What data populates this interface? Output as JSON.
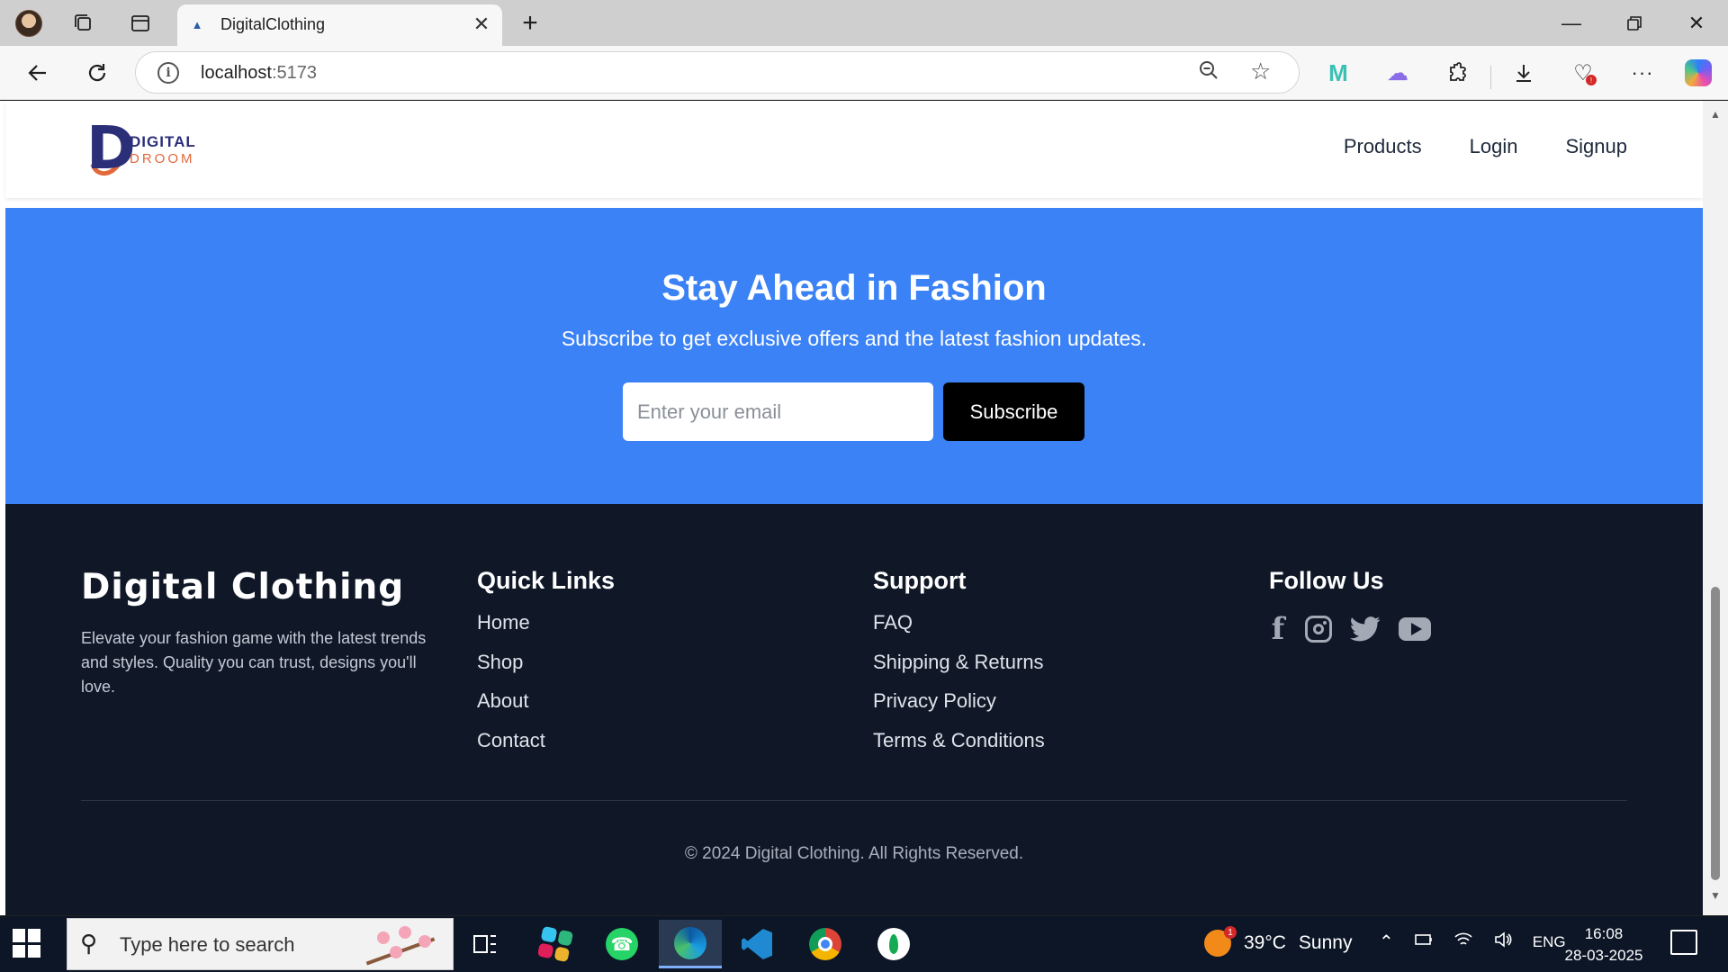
{
  "browser": {
    "tab_title": "DigitalClothing",
    "url_host": "localhost",
    "url_port": ":5173"
  },
  "site": {
    "logo_top": "DIGITAL",
    "logo_bottom": "DROOM",
    "nav": [
      "Products",
      "Login",
      "Signup"
    ]
  },
  "subscribe": {
    "title": "Stay Ahead in Fashion",
    "subtitle": "Subscribe to get exclusive offers and the latest fashion updates.",
    "email_placeholder": "Enter your email",
    "button": "Subscribe"
  },
  "footer": {
    "brand": "Digital Clothing",
    "description": "Elevate your fashion game with the latest trends and styles. Quality you can trust, designs you'll love.",
    "quick_links": {
      "title": "Quick Links",
      "items": [
        "Home",
        "Shop",
        "About",
        "Contact"
      ]
    },
    "support": {
      "title": "Support",
      "items": [
        "FAQ",
        "Shipping & Returns",
        "Privacy Policy",
        "Terms & Conditions"
      ]
    },
    "follow": {
      "title": "Follow Us",
      "icons": [
        "facebook-icon",
        "instagram-icon",
        "twitter-icon",
        "youtube-icon"
      ]
    },
    "copyright": "© 2024 Digital Clothing. All Rights Reserved."
  },
  "taskbar": {
    "search_placeholder": "Type here to search",
    "weather_badge": "1",
    "weather_temp": "39°C",
    "weather_condition": "Sunny",
    "language": "ENG",
    "time": "16:08",
    "date": "28-03-2025"
  },
  "colors": {
    "subscribe_bg": "#3b82f6",
    "footer_bg": "#101828",
    "button_bg": "#000000"
  }
}
